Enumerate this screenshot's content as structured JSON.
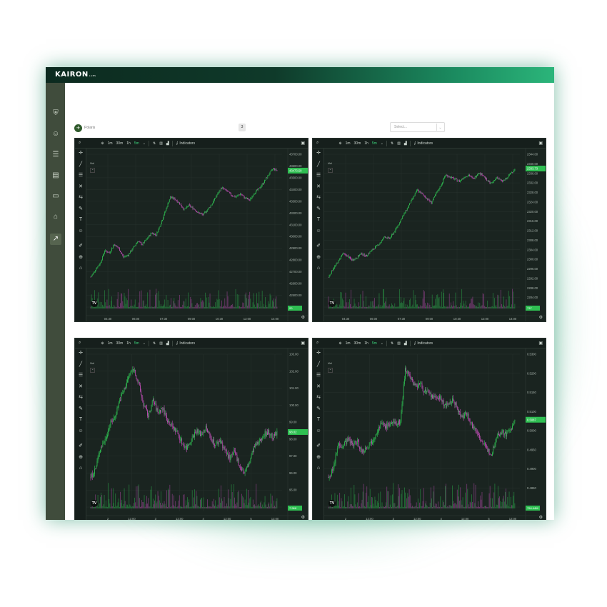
{
  "app": {
    "logo_text": "KAIRON",
    "logo_sub": "LABS",
    "colors": {
      "accent": "#2bb57a",
      "up": "#2fbf52",
      "down": "#c24fb8",
      "panel_bg": "#1a2420",
      "sidebar": "#404c3c"
    }
  },
  "sidebar": {
    "items": [
      {
        "icon": "shield-icon",
        "glyph": "⛨"
      },
      {
        "icon": "users-icon",
        "glyph": "☺"
      },
      {
        "icon": "list-icon",
        "glyph": "☰"
      },
      {
        "icon": "clipboard-icon",
        "glyph": "▤"
      },
      {
        "icon": "document-icon",
        "glyph": "▭"
      },
      {
        "icon": "bank-icon",
        "glyph": "⌂"
      },
      {
        "icon": "trend-icon",
        "glyph": "↗"
      }
    ]
  },
  "controls": {
    "add_label": "Polaris",
    "count": "3",
    "select_placeholder": "Select..."
  },
  "toolbar": {
    "timeframes": [
      "1m",
      "30m",
      "1h",
      "5m"
    ],
    "active_timeframe": "5m",
    "indicators_label": "Indicators"
  },
  "panels": [
    {
      "vol_label": "Vol",
      "price_label": "43473.50",
      "vol_badge": "20",
      "y_ticks": [
        "43700.00",
        "43600.00",
        "43500.00",
        "43400.00",
        "43300.00",
        "43200.00",
        "43100.00",
        "43000.00",
        "42900.00",
        "42800.00",
        "42700.00",
        "42600.00",
        "42500.00",
        "42400.00"
      ],
      "x_ticks": [
        "04:30",
        "06:00",
        "07:30",
        "09:00",
        "10:30",
        "12:00",
        "14:00"
      ],
      "chart_data": {
        "type": "line",
        "series_close": [
          42450,
          42520,
          42580,
          42700,
          42680,
          42760,
          42720,
          42640,
          42660,
          42720,
          42790,
          42760,
          42810,
          42870,
          42850,
          42960,
          43080,
          43210,
          43190,
          43150,
          43090,
          43130,
          43100,
          43060,
          43040,
          43090,
          43150,
          43230,
          43300,
          43270,
          43230,
          43210,
          43240,
          43200,
          43180,
          43250,
          43290,
          43350,
          43420,
          43480,
          43460
        ]
      }
    },
    {
      "vol_label": "Vol",
      "price_label": "2333.73",
      "vol_badge": "737",
      "y_ticks": [
        "2344.00",
        "2340.00",
        "2336.00",
        "2332.00",
        "2328.00",
        "2324.00",
        "2320.00",
        "2316.00",
        "2312.00",
        "2308.00",
        "2304.00",
        "2300.00",
        "2296.00",
        "2292.00",
        "2288.00",
        "2284.00",
        "2280.00"
      ],
      "x_ticks": [
        "04:30",
        "06:00",
        "07:30",
        "09:00",
        "10:30",
        "12:00",
        "14:00"
      ],
      "chart_data": {
        "type": "line",
        "series_close": [
          2285,
          2289,
          2292,
          2296,
          2295,
          2293,
          2294,
          2296,
          2295,
          2297,
          2299,
          2301,
          2304,
          2303,
          2306,
          2310,
          2314,
          2318,
          2322,
          2326,
          2324,
          2322,
          2320,
          2324,
          2328,
          2333,
          2332,
          2331,
          2330,
          2332,
          2333,
          2331,
          2334,
          2333,
          2330,
          2329,
          2332,
          2330,
          2331,
          2334,
          2336
        ]
      }
    },
    {
      "vol_label": "Vol",
      "price_label": "98.02",
      "vol_badge": "7.96K",
      "y_ticks": [
        "103.00",
        "102.00",
        "101.00",
        "100.00",
        "99.00",
        "98.00",
        "97.00",
        "96.00",
        "95.00",
        "94.50"
      ],
      "x_ticks": [
        "2",
        "12:00",
        "3",
        "12:00",
        "4",
        "12:00",
        "5",
        "12:00"
      ],
      "chart_data": {
        "type": "line",
        "series_close": [
          94.6,
          95.2,
          96.8,
          97.4,
          98.6,
          99.1,
          100.4,
          101.2,
          102.3,
          102.8,
          101.6,
          100.1,
          99.2,
          100.4,
          99.5,
          99.8,
          98.9,
          98.4,
          98.0,
          97.2,
          96.8,
          97.5,
          98.1,
          97.8,
          98.3,
          97.6,
          97.0,
          97.4,
          96.6,
          96.0,
          96.5,
          95.5,
          94.9,
          95.6,
          96.8,
          97.2,
          97.8,
          98.0,
          97.6,
          98.0
        ]
      }
    },
    {
      "vol_label": "Vol",
      "price_label": "0.5087",
      "vol_badge": "754.44M",
      "y_ticks": [
        "0.5300",
        "0.5200",
        "0.5150",
        "0.5100",
        "0.5000",
        "0.4950",
        "0.4900",
        "0.4850",
        "0.4800"
      ],
      "x_ticks": [
        "2",
        "12:00",
        "3",
        "12:00",
        "4",
        "12:00",
        "5",
        "12:00"
      ],
      "chart_data": {
        "type": "line",
        "series_close": [
          0.486,
          0.489,
          0.499,
          0.4985,
          0.501,
          0.499,
          0.5,
          0.496,
          0.498,
          0.5,
          0.504,
          0.507,
          0.506,
          0.5075,
          0.507,
          0.508,
          0.529,
          0.526,
          0.522,
          0.523,
          0.52,
          0.519,
          0.517,
          0.518,
          0.515,
          0.514,
          0.517,
          0.512,
          0.51,
          0.511,
          0.506,
          0.504,
          0.5,
          0.497,
          0.495,
          0.502,
          0.504,
          0.503,
          0.505,
          0.5087
        ]
      }
    }
  ]
}
